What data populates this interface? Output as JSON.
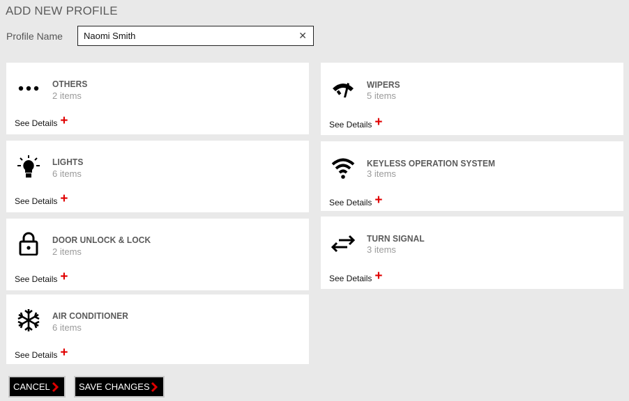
{
  "header": {
    "title": "ADD NEW PROFILE"
  },
  "profile": {
    "label": "Profile Name",
    "value": "Naomi Smith"
  },
  "cards": {
    "others": {
      "title": "OTHERS",
      "count": "2 items",
      "details": "See Details"
    },
    "wipers": {
      "title": "WIPERS",
      "count": "5 items",
      "details": "See Details"
    },
    "lights": {
      "title": "LIGHTS",
      "count": "6 items",
      "details": "See Details"
    },
    "keyless": {
      "title": "KEYLESS OPERATION SYSTEM",
      "count": "3 items",
      "details": "See Details"
    },
    "door": {
      "title": "DOOR UNLOCK & LOCK",
      "count": "2 items",
      "details": "See Details"
    },
    "turn": {
      "title": "TURN SIGNAL",
      "count": "3 items",
      "details": "See Details"
    },
    "ac": {
      "title": "AIR CONDITIONER",
      "count": "6 items",
      "details": "See Details"
    }
  },
  "buttons": {
    "cancel": "CANCEL",
    "save": "SAVE CHANGES"
  },
  "colors": {
    "accent": "#e00000",
    "button_bg": "#000000",
    "page_bg": "#e9e9e9"
  }
}
